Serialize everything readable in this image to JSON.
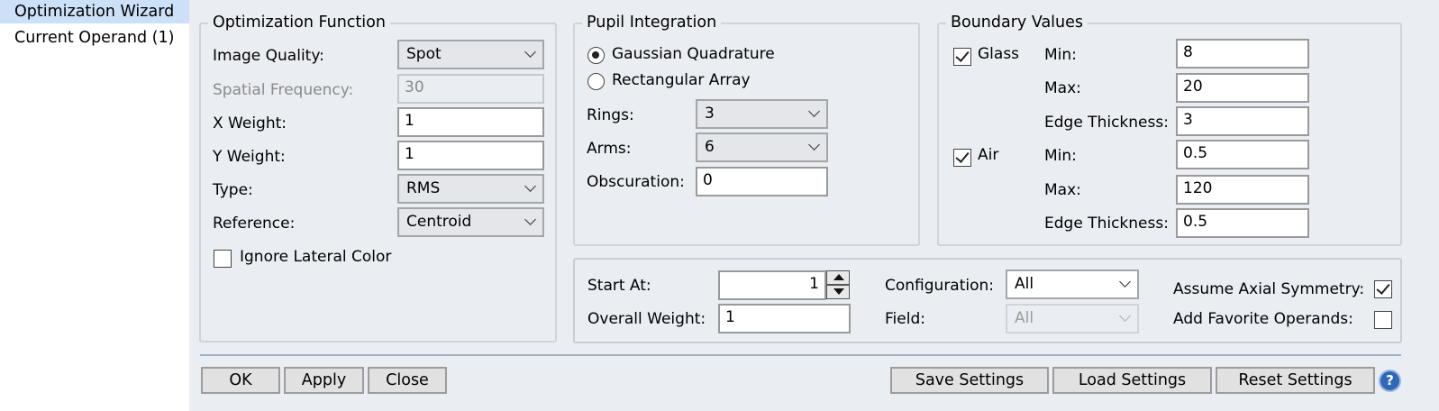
{
  "nav": {
    "items": [
      {
        "label": "Optimization Wizard",
        "selected": true
      },
      {
        "label": "Current Operand (1)",
        "selected": false
      }
    ]
  },
  "optimization_function": {
    "title": "Optimization Function",
    "image_quality": {
      "label": "Image Quality:",
      "value": "Spot"
    },
    "spatial_frequency": {
      "label": "Spatial Frequency:",
      "value": "30"
    },
    "x_weight": {
      "label": "X Weight:",
      "value": "1"
    },
    "y_weight": {
      "label": "Y Weight:",
      "value": "1"
    },
    "type": {
      "label": "Type:",
      "value": "RMS"
    },
    "reference": {
      "label": "Reference:",
      "value": "Centroid"
    },
    "ignore_lateral_color": {
      "label": "Ignore Lateral Color",
      "checked": false
    }
  },
  "pupil_integration": {
    "title": "Pupil Integration",
    "gaussian": {
      "label": "Gaussian Quadrature",
      "selected": true
    },
    "rectangular": {
      "label": "Rectangular Array",
      "selected": false
    },
    "rings": {
      "label": "Rings:",
      "value": "3"
    },
    "arms": {
      "label": "Arms:",
      "value": "6"
    },
    "obscuration": {
      "label": "Obscuration:",
      "value": "0"
    }
  },
  "boundary_values": {
    "title": "Boundary Values",
    "glass": {
      "label": "Glass",
      "checked": true,
      "min_label": "Min:",
      "min": "8",
      "max_label": "Max:",
      "max": "20",
      "edge_label": "Edge Thickness:",
      "edge": "3"
    },
    "air": {
      "label": "Air",
      "checked": true,
      "min_label": "Min:",
      "min": "0.5",
      "max_label": "Max:",
      "max": "120",
      "edge_label": "Edge Thickness:",
      "edge": "0.5"
    }
  },
  "settings": {
    "start_at": {
      "label": "Start At:",
      "value": "1"
    },
    "overall_weight": {
      "label": "Overall Weight:",
      "value": "1"
    },
    "configuration": {
      "label": "Configuration:",
      "value": "All"
    },
    "field": {
      "label": "Field:",
      "value": "All"
    },
    "assume_axial_symmetry": {
      "label": "Assume Axial Symmetry:",
      "checked": true
    },
    "add_favorite_operands": {
      "label": "Add Favorite Operands:",
      "checked": false
    }
  },
  "buttons": {
    "ok": "OK",
    "apply": "Apply",
    "close": "Close",
    "save_settings": "Save Settings",
    "load_settings": "Load Settings",
    "reset_settings": "Reset Settings",
    "help": "?"
  },
  "colors": {
    "panel_bg": "#eaedf2",
    "nav_selected": "#cce0f7",
    "help_icon": "#2f68b8"
  }
}
